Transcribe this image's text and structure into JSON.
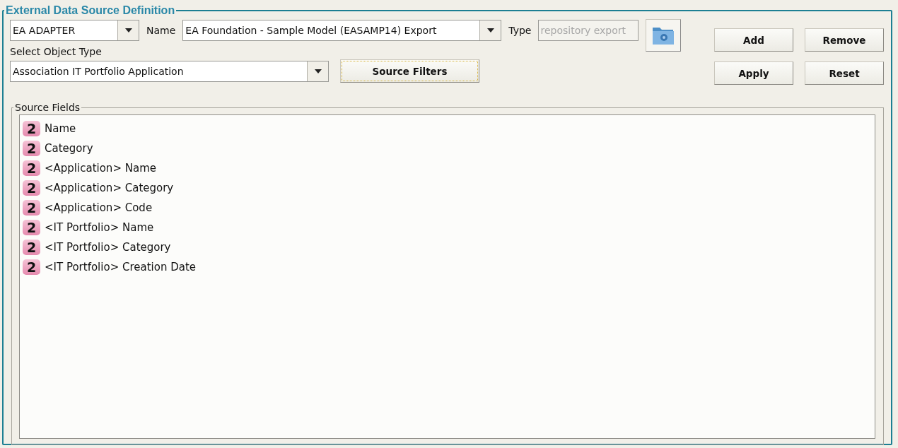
{
  "panel": {
    "title": "External Data Source Definition"
  },
  "adapter": {
    "value": "EA ADAPTER"
  },
  "name_label": "Name",
  "name": {
    "value": "EA Foundation - Sample Model (EASAMP14) Export"
  },
  "type_label": "Type",
  "type": {
    "value": "repository export",
    "disabled": true
  },
  "object_type_label": "Select Object Type",
  "object_type": {
    "value": "Association IT Portfolio Application"
  },
  "source_filters_button": {
    "label": "Source Filters",
    "focused": true
  },
  "buttons": [
    {
      "label": "Add"
    },
    {
      "label": "Remove"
    },
    {
      "label": "Apply"
    },
    {
      "label": "Reset"
    }
  ],
  "source_fields": {
    "title": "Source Fields",
    "items": [
      {
        "badge": "2",
        "label": "Name"
      },
      {
        "badge": "2",
        "label": "Category"
      },
      {
        "badge": "2",
        "label": "<Application> Name"
      },
      {
        "badge": "2",
        "label": "<Application> Category"
      },
      {
        "badge": "2",
        "label": "<Application> Code"
      },
      {
        "badge": "2",
        "label": "<IT Portfolio> Name"
      },
      {
        "badge": "2",
        "label": "<IT Portfolio> Category"
      },
      {
        "badge": "2",
        "label": "<IT Portfolio> Creation Date"
      }
    ]
  }
}
